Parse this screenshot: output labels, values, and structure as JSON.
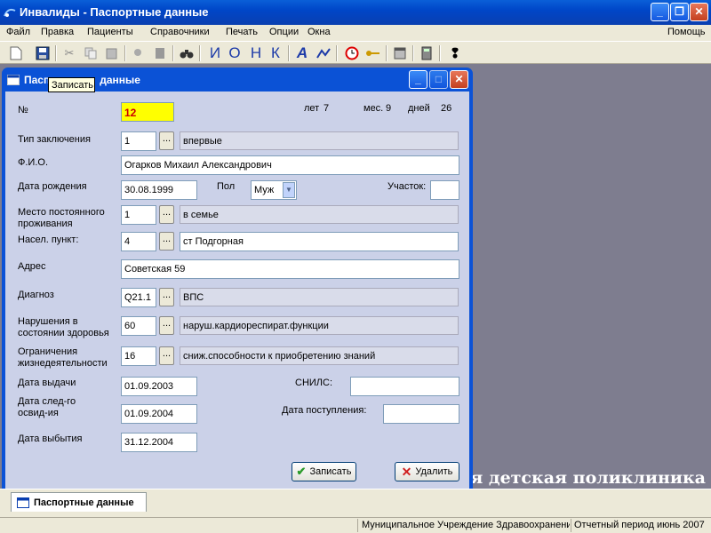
{
  "app": {
    "title": "Инвалиды - Паспортные данные"
  },
  "menu": {
    "items": [
      "Файл",
      "Правка",
      "Пациенты",
      "Справочники",
      "Печать",
      "Опции",
      "Окна"
    ],
    "help": "Помощь"
  },
  "toolbar": {
    "letters": [
      "И",
      "О",
      "Н",
      "К",
      "А"
    ]
  },
  "tooltip": {
    "text": "Записать"
  },
  "child": {
    "title": "Пасп",
    "title_rest": "данные"
  },
  "form": {
    "number_label": "№",
    "number_value": "12",
    "age": {
      "years_label": "лет",
      "years": "7",
      "months_label": "мес.",
      "months": "9",
      "days_label": "дней",
      "days": "26"
    },
    "conclusion_type": {
      "label": "Тип заключения",
      "code": "1",
      "text": "впервые"
    },
    "fio": {
      "label": "Ф.И.О.",
      "value": "Огарков Михаил Александрович"
    },
    "birth_date": {
      "label": "Дата рождения",
      "value": "30.08.1999"
    },
    "sex": {
      "label": "Пол",
      "value": "Муж"
    },
    "district": {
      "label": "Участок:",
      "value": ""
    },
    "residence": {
      "label1": "Место постоянного",
      "label2": "проживания",
      "code": "1",
      "text": "в семье"
    },
    "locality": {
      "label": "Насел. пункт:",
      "code": "4",
      "text": "ст Подгорная"
    },
    "address": {
      "label": "Адрес",
      "value": "Советская 59"
    },
    "diagnosis": {
      "label": "Диагноз",
      "code": "Q21.1",
      "text": "ВПС"
    },
    "health_violations": {
      "label1": "Нарушения в",
      "label2": "состоянии здоровья",
      "code": "60",
      "text": "наруш.кардиореспират.функции"
    },
    "restrictions": {
      "label1": "Ограничения",
      "label2": "жизнедеятельности",
      "code": "16",
      "text": "сниж.способности к приобретению знаний"
    },
    "issue_date": {
      "label": "Дата выдачи",
      "value": "01.09.2003"
    },
    "snils": {
      "label": "СНИЛС:",
      "value": ""
    },
    "next_exam": {
      "label1": "Дата след-го",
      "label2": "освид-ия",
      "value": "01.09.2004"
    },
    "arrival_date": {
      "label": "Дата поступления:",
      "value": ""
    },
    "exit_date": {
      "label": "Дата выбытия",
      "value": "31.12.2004"
    },
    "dots": "...",
    "save_button": "Записать",
    "delete_button": "Удалить"
  },
  "background_text": "ая детская поликлиника",
  "taskbar": {
    "tab": "Паспортные данные"
  },
  "status": {
    "institution": "Муниципальное Учреждение Здравоохранени",
    "period": "Отчетный период июнь 2007"
  },
  "colors": {
    "title_blue": "#0046c8",
    "form_bg": "#cbd1e8",
    "highlight_field": "#ffff00",
    "number_text": "#cc0000",
    "workspace": "#7e7d8f"
  }
}
